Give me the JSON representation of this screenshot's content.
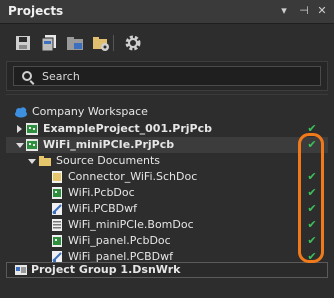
{
  "panel": {
    "title": "Projects",
    "window_buttons": [
      "▾",
      "⊣",
      "✕"
    ]
  },
  "toolbar": {
    "buttons": [
      "save-icon",
      "save-all-icon",
      "open-project-icon",
      "folder-settings-icon",
      "gear-icon"
    ]
  },
  "search": {
    "placeholder": "Search"
  },
  "tree": {
    "workspace": "Company Workspace",
    "items": [
      {
        "label": "ExampleProject_001.PrjPcb",
        "bold": true,
        "expanded": false,
        "status": "ok"
      },
      {
        "label": "WiFi_miniPCIe.PrjPcb",
        "bold": true,
        "expanded": true,
        "status": "ok"
      },
      {
        "label": "Source Documents",
        "bold": false,
        "expanded": true
      },
      {
        "label": "Connector_WiFi.SchDoc",
        "status": "ok"
      },
      {
        "label": "WiFi.PcbDoc",
        "status": "ok"
      },
      {
        "label": "WiFi.PCBDwf",
        "status": "ok"
      },
      {
        "label": "WiFi_miniPCIe.BomDoc",
        "status": "ok"
      },
      {
        "label": "WiFi_panel.PcbDoc",
        "status": "ok"
      },
      {
        "label": "WiFi_panel.PCBDwf",
        "status": "ok"
      }
    ],
    "group": "Project Group 1.DsnWrk"
  },
  "colors": {
    "accent_highlight": "#f07a1a",
    "status_ok": "#3cc45a"
  }
}
